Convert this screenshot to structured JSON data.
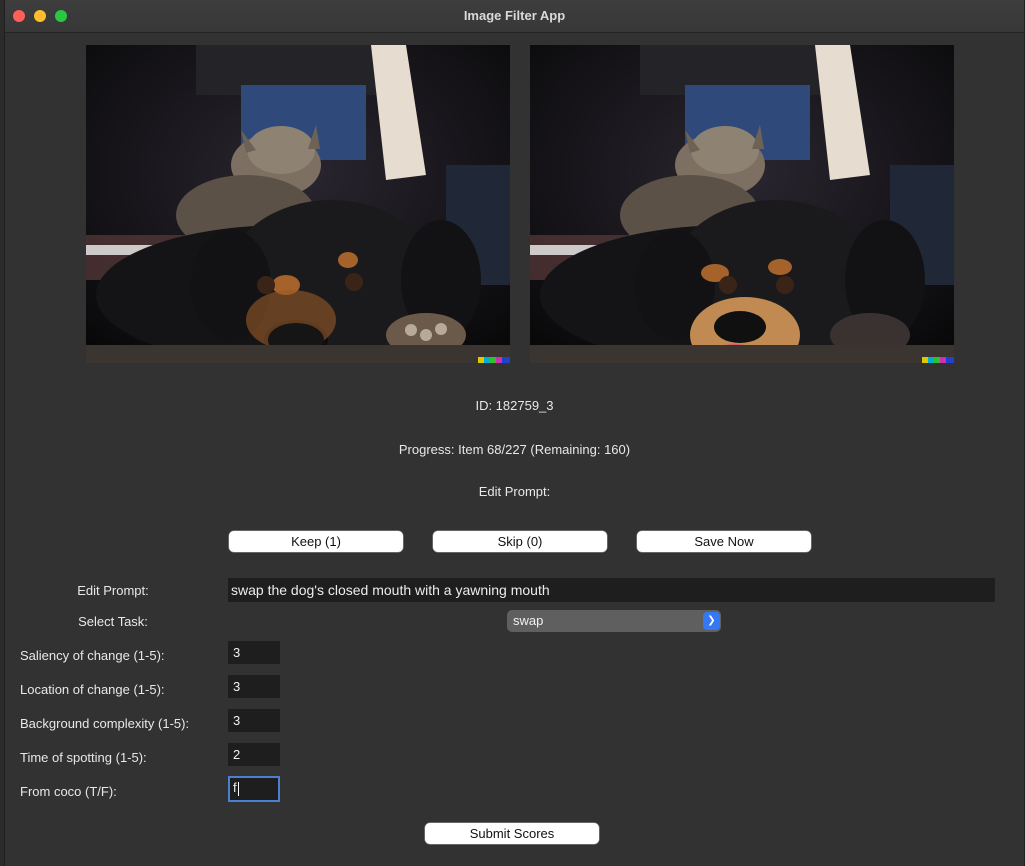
{
  "window": {
    "title": "Image Filter App"
  },
  "images": {
    "original": {
      "description": "original",
      "subject": "dog-and-cat-photo"
    },
    "edited": {
      "description": "edited",
      "subject": "dog-yawning-edit"
    }
  },
  "info": {
    "id_text": "ID: 182759_3",
    "progress_text": "Progress: Item 68/227 (Remaining: 160)",
    "edit_prompt_heading": "Edit Prompt:"
  },
  "buttons": {
    "keep": "Keep (1)",
    "skip": "Skip (0)",
    "save": "Save Now",
    "submit": "Submit Scores"
  },
  "form": {
    "edit_prompt_label": "Edit Prompt:",
    "edit_prompt_value": "swap the dog's closed mouth with a yawning mouth",
    "task_label": "Select Task:",
    "task_value": "swap",
    "fields": [
      {
        "label": "Saliency of change (1-5):",
        "value": "3"
      },
      {
        "label": "Location of change (1-5):",
        "value": "3"
      },
      {
        "label": "Background complexity (1-5):",
        "value": "3"
      },
      {
        "label": "Time of spotting (1-5):",
        "value": "2"
      },
      {
        "label": "From coco (T/F):",
        "value": "f"
      }
    ]
  },
  "colors": {
    "accent": "#3478f6",
    "background": "#323232",
    "input_bg": "#1e1e1e"
  }
}
